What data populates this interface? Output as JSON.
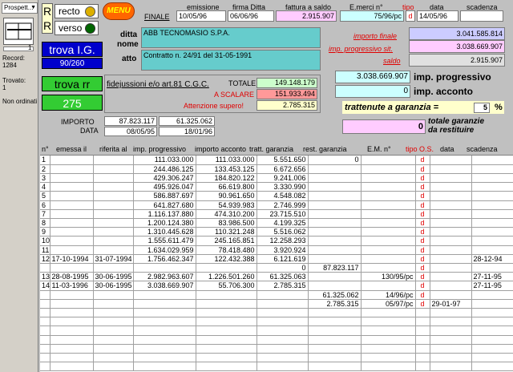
{
  "sidebar": {
    "dropdown": "Prospett...",
    "record_label": "Record:",
    "record_value": "1284",
    "found_label": "Trovato:",
    "found_value": "1",
    "non_ordered": "Non ordinati",
    "counter": "1"
  },
  "toggle": {
    "r1": "R",
    "r2": "R",
    "recto": "recto",
    "verso": "verso"
  },
  "menu_label": "MENU",
  "header": {
    "finale_label": "FINALE",
    "emissione_label": "emissione",
    "firma_label": "firma Ditta",
    "fattura_label": "fattura a saldo",
    "emerci_label": "E.merci  n°",
    "tipo_label": "tipo",
    "data_label": "data",
    "scadenza_label": "scadenza",
    "emissione": "10/05/96",
    "firma": "06/06/96",
    "fattura": "2.915.907",
    "emerci": "75/96/pc",
    "tipo": "d",
    "data": "14/05/96",
    "scadenza": ""
  },
  "ditta": {
    "ditta_label": "ditta",
    "nome_label": "nome",
    "atto_label": "atto",
    "nome": "ABB TECNOMASIO S.P.A.",
    "atto": "Contratto n. 24/91 del 31-05-1991"
  },
  "trova": {
    "ig_label": "trova I.G.",
    "ig_count": "90/260",
    "rr_label": "trova rr",
    "rr_count": "275"
  },
  "totals": {
    "importo_finale_label": "importo finale",
    "importo_finale": "3.041.585.814",
    "progressivo_sit_label": "imp. progressivo sit.",
    "progressivo_sit": "3.038.669.907",
    "saldo_label": "saldo",
    "saldo": "2.915.907"
  },
  "fidejussioni": {
    "title": "fidejussioni  e/o art.81 C.G.C.",
    "totale_label": "TOTALE",
    "totale": "149.148.179",
    "scalare_label": "A SCALARE",
    "scalare": "151.933.494",
    "attenzione_label": "Attenzione supero!",
    "attenzione": "2.785.315",
    "importo_label": "IMPORTO",
    "data_label": "DATA",
    "importo1": "87.823.117",
    "importo2": "61.325.062",
    "data1": "08/05/95",
    "data2": "18/01/96"
  },
  "progressivo": {
    "imp_prog_value": "3.038.669.907",
    "imp_prog_label": "imp. progressivo",
    "imp_acc_value": "0",
    "imp_acc_label": "imp. acconto",
    "trattenute_label": "trattenute a garanzia =",
    "trattenute_pct": "5",
    "pct_sign": "%",
    "restituire_value": "0",
    "restituire_label1": "totale garanzie",
    "restituire_label2": "da restituire"
  },
  "table": {
    "headers": [
      "n°",
      "emessa il",
      "riferita al",
      "imp. progressivo",
      "importo acconto",
      "tratt. garanzia",
      "rest. garanzia",
      "E.M. n°",
      "tipo O.S.",
      "data",
      "scadenza"
    ],
    "rows": [
      [
        "1",
        "",
        "",
        "111.033.000",
        "111.033.000",
        "5.551.650",
        "0",
        "",
        "d",
        "",
        ""
      ],
      [
        "2",
        "",
        "",
        "244.486.125",
        "133.453.125",
        "6.672.656",
        "",
        "",
        "d",
        "",
        ""
      ],
      [
        "3",
        "",
        "",
        "429.306.247",
        "184.820.122",
        "9.241.006",
        "",
        "",
        "d",
        "",
        ""
      ],
      [
        "4",
        "",
        "",
        "495.926.047",
        "66.619.800",
        "3.330.990",
        "",
        "",
        "d",
        "",
        ""
      ],
      [
        "5",
        "",
        "",
        "586.887.697",
        "90.961.650",
        "4.548.082",
        "",
        "",
        "d",
        "",
        ""
      ],
      [
        "6",
        "",
        "",
        "641.827.680",
        "54.939.983",
        "2.746.999",
        "",
        "",
        "d",
        "",
        ""
      ],
      [
        "7",
        "",
        "",
        "1.116.137.880",
        "474.310.200",
        "23.715.510",
        "",
        "",
        "d",
        "",
        ""
      ],
      [
        "8",
        "",
        "",
        "1.200.124.380",
        "83.986.500",
        "4.199.325",
        "",
        "",
        "d",
        "",
        ""
      ],
      [
        "9",
        "",
        "",
        "1.310.445.628",
        "110.321.248",
        "5.516.062",
        "",
        "",
        "d",
        "",
        ""
      ],
      [
        "10",
        "",
        "",
        "1.555.611.479",
        "245.165.851",
        "12.258.293",
        "",
        "",
        "d",
        "",
        ""
      ],
      [
        "11",
        "",
        "",
        "1.634.029.959",
        "78.418.480",
        "3.920.924",
        "",
        "",
        "d",
        "",
        ""
      ],
      [
        "12",
        "17-10-1994",
        "31-07-1994",
        "1.756.462.347",
        "122.432.388",
        "6.121.619",
        "",
        "",
        "d",
        "",
        "28-12-94"
      ],
      [
        "",
        "",
        "",
        "",
        "",
        "0",
        "87.823.117",
        "",
        "d",
        "",
        ""
      ],
      [
        "13",
        "28-08-1995",
        "30-06-1995",
        "2.982.963.607",
        "1.226.501.260",
        "61.325.063",
        "",
        "130/95/pc",
        "d",
        "",
        "27-11-95"
      ],
      [
        "14",
        "11-03-1996",
        "30-06-1995",
        "3.038.669.907",
        "55.706.300",
        "2.785.315",
        "",
        "",
        "d",
        "",
        "27-11-95"
      ],
      [
        "",
        "",
        "",
        "",
        "",
        "",
        "61.325.062",
        "14/96/pc",
        "d",
        "",
        ""
      ],
      [
        "",
        "",
        "",
        "",
        "",
        "",
        "2.785.315",
        "05/97/pc",
        "d",
        "29-01-97",
        ""
      ],
      [
        "",
        "",
        "",
        "",
        "",
        "",
        "",
        "",
        "",
        "",
        ""
      ],
      [
        "",
        "",
        "",
        "",
        "",
        "",
        "",
        "",
        "",
        "",
        ""
      ],
      [
        "",
        "",
        "",
        "",
        "",
        "",
        "",
        "",
        "",
        "",
        ""
      ],
      [
        "",
        "",
        "",
        "",
        "",
        "",
        "",
        "",
        "",
        "",
        ""
      ],
      [
        "",
        "",
        "",
        "",
        "",
        "",
        "",
        "",
        "",
        "",
        ""
      ],
      [
        "",
        "",
        "",
        "",
        "",
        "",
        "",
        "",
        "",
        "",
        ""
      ],
      [
        "",
        "",
        "",
        "",
        "",
        "",
        "",
        "",
        "",
        "",
        ""
      ]
    ]
  },
  "colors": {
    "accent_green": "#33cc33",
    "accent_blue": "#0000cc",
    "cyan": "#66cccc",
    "pink": "#ffccff",
    "light_blue": "#ccccff",
    "red": "#e00000",
    "orange": "#ff6600"
  }
}
